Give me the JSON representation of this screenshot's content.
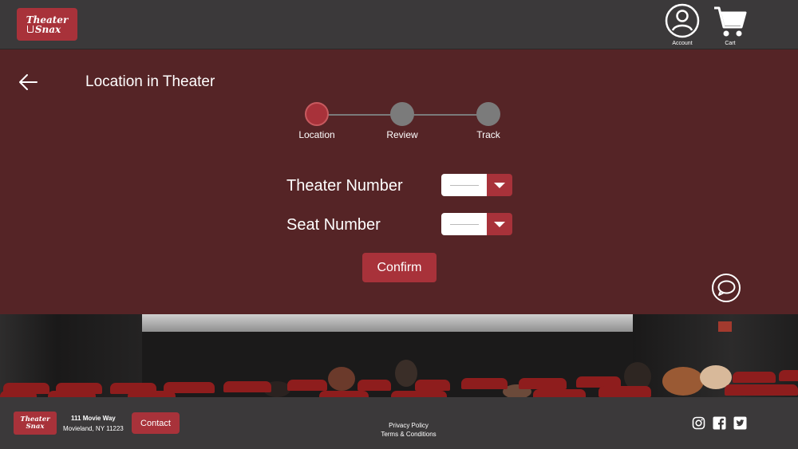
{
  "header": {
    "logo": {
      "line1": "Theater",
      "line2": "Snax"
    },
    "account_label": "Account",
    "cart_label": "Cart"
  },
  "main": {
    "title": "Location in Theater",
    "steps": [
      {
        "label": "Location",
        "state": "active"
      },
      {
        "label": "Review",
        "state": "inactive"
      },
      {
        "label": "Track",
        "state": "inactive"
      }
    ],
    "fields": {
      "theater_number": {
        "label": "Theater Number",
        "value": ""
      },
      "seat_number": {
        "label": "Seat Number",
        "value": ""
      }
    },
    "confirm_label": "Confirm"
  },
  "footer": {
    "logo": {
      "line1": "Theater",
      "line2": "Snax"
    },
    "address_line1": "111 Movie Way",
    "address_line2": "Movieland, NY 11223",
    "contact_label": "Contact",
    "privacy_label": "Privacy Policy",
    "terms_label": "Terms & Conditions",
    "social": [
      "instagram-icon",
      "facebook-icon",
      "twitter-icon"
    ]
  },
  "colors": {
    "header_bg": "#3b393a",
    "panel_bg": "#552426",
    "accent": "#a8323a",
    "step_inactive": "#7b7b7b"
  }
}
